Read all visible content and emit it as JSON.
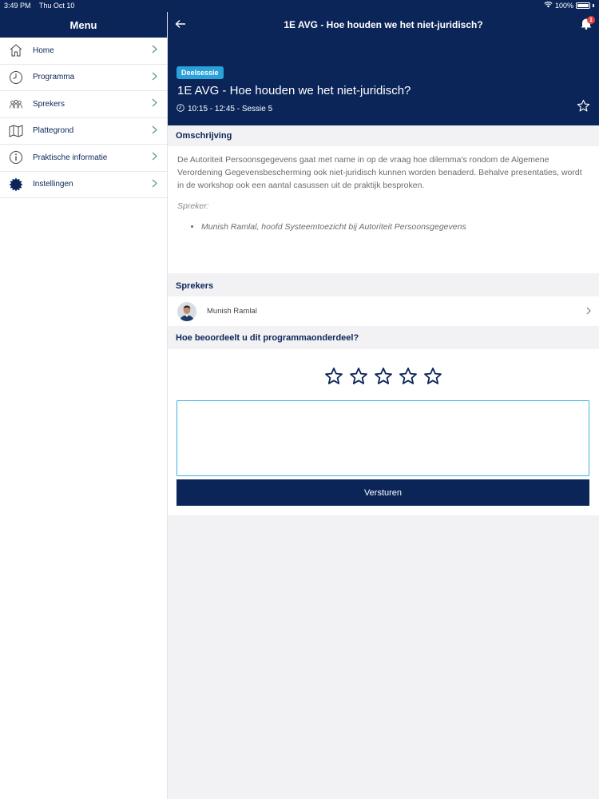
{
  "status_bar": {
    "time": "3:49 PM",
    "date": "Thu Oct 10",
    "battery": "100%"
  },
  "sidebar": {
    "title": "Menu",
    "items": [
      {
        "label": "Home",
        "icon": "home-icon"
      },
      {
        "label": "Programma",
        "icon": "clock-icon"
      },
      {
        "label": "Sprekers",
        "icon": "people-icon"
      },
      {
        "label": "Plattegrond",
        "icon": "map-icon"
      },
      {
        "label": "Praktische informatie",
        "icon": "info-icon"
      },
      {
        "label": "Instellingen",
        "icon": "gear-icon"
      }
    ]
  },
  "header": {
    "title": "1E AVG - Hoe houden we het niet-juridisch?",
    "notification_count": "1"
  },
  "session": {
    "badge": "Deelsessie",
    "title": "1E AVG - Hoe houden we het niet-juridisch?",
    "time": "10:15 - 12:45 - Sessie 5"
  },
  "description": {
    "heading": "Omschrijving",
    "text": "De Autoriteit Persoonsgegevens gaat met name in op de vraag hoe dilemma's rondom de Algemene Verordening Gegevensbescherming ook niet-juridisch kunnen worden benaderd. Behalve presentaties, wordt in de workshop ook een aantal casussen uit de praktijk besproken.",
    "speaker_label": "Spreker:",
    "speakers": [
      "Munish Ramlal, hoofd Systeemtoezicht bij Autoriteit Persoonsgegevens"
    ]
  },
  "speakers_section": {
    "heading": "Sprekers",
    "items": [
      {
        "name": "Munish Ramlal"
      }
    ]
  },
  "rating": {
    "heading": "Hoe beoordeelt u dit programmaonderdeel?",
    "stars_total": 5,
    "stars_selected": 0,
    "comment_value": "",
    "submit_label": "Versturen"
  },
  "colors": {
    "primary": "#0b2559",
    "accent": "#2ba1d9",
    "input_border": "#3eb4e3",
    "chevron": "#5a9a86",
    "badge_alert": "#e8413c"
  }
}
